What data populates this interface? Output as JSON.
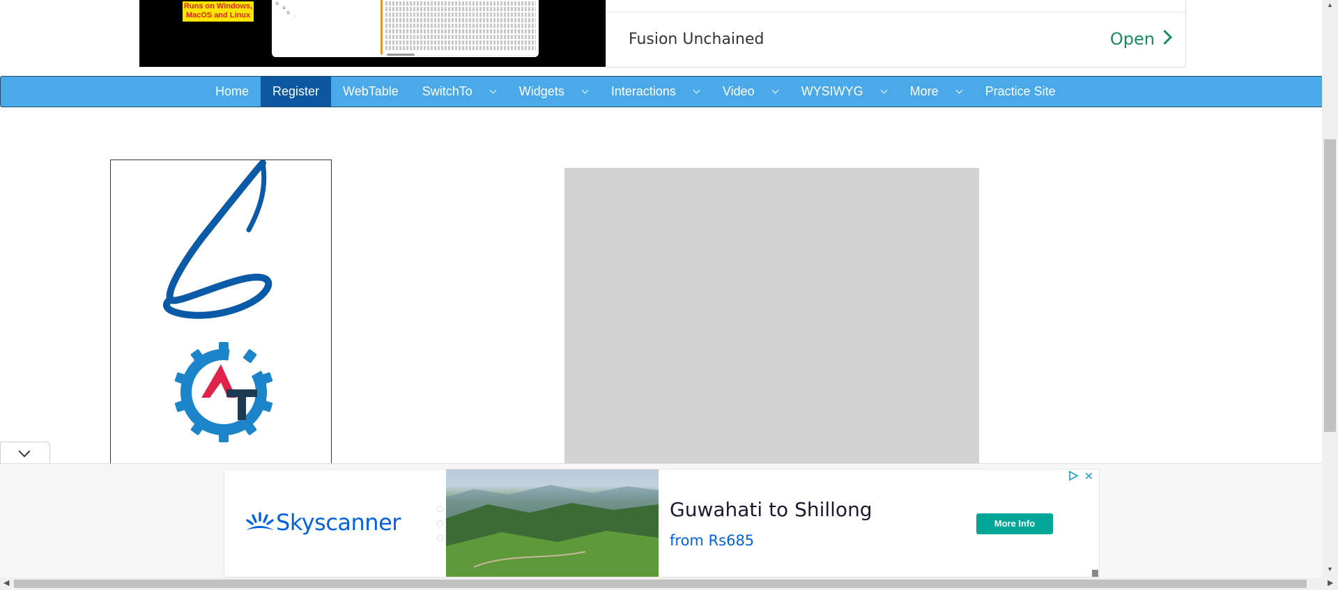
{
  "top_ad": {
    "badge_line1": "Runs on Windows,",
    "badge_line2": "MacOS and Linux",
    "title": "Fusion Unchained",
    "open_label": "Open"
  },
  "nav": {
    "items": [
      {
        "label": "Home",
        "dropdown": false,
        "active": false
      },
      {
        "label": "Register",
        "dropdown": false,
        "active": true
      },
      {
        "label": "WebTable",
        "dropdown": false,
        "active": false
      },
      {
        "label": "SwitchTo",
        "dropdown": true,
        "active": false
      },
      {
        "label": "Widgets",
        "dropdown": true,
        "active": false
      },
      {
        "label": "Interactions",
        "dropdown": true,
        "active": false
      },
      {
        "label": "Video",
        "dropdown": true,
        "active": false
      },
      {
        "label": "WYSIWYG",
        "dropdown": true,
        "active": false
      },
      {
        "label": "More",
        "dropdown": true,
        "active": false
      },
      {
        "label": "Practice Site",
        "dropdown": false,
        "active": false
      }
    ]
  },
  "bottom_ad": {
    "brand": "Skyscanner",
    "headline": "Guwahati to Shillong",
    "price": "from Rs685",
    "cta": "More Info"
  },
  "colors": {
    "nav_bg": "#4aa9e9",
    "nav_active": "#0c58a0",
    "brand_blue": "#0062e3",
    "cta_teal": "#00a698",
    "open_green": "#1a8a5a"
  }
}
